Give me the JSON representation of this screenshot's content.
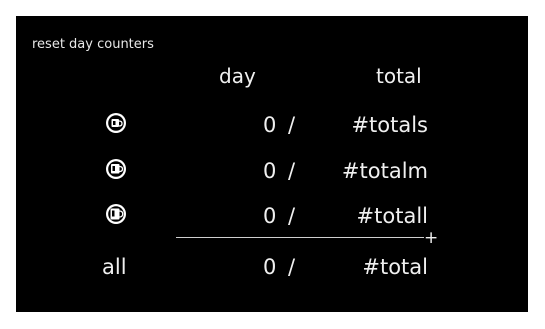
{
  "title": "reset day counters",
  "headers": {
    "day": "day",
    "total": "total"
  },
  "rows": [
    {
      "icon": "small-cup-icon",
      "day": "0",
      "sep": "/",
      "total": "#totals"
    },
    {
      "icon": "medium-cup-icon",
      "day": "0",
      "sep": "/",
      "total": "#totalm"
    },
    {
      "icon": "large-cup-icon",
      "day": "0",
      "sep": "/",
      "total": "#totall"
    }
  ],
  "sum_symbol": "+",
  "all_row": {
    "label": "all",
    "day": "0",
    "sep": "/",
    "total": "#total"
  }
}
